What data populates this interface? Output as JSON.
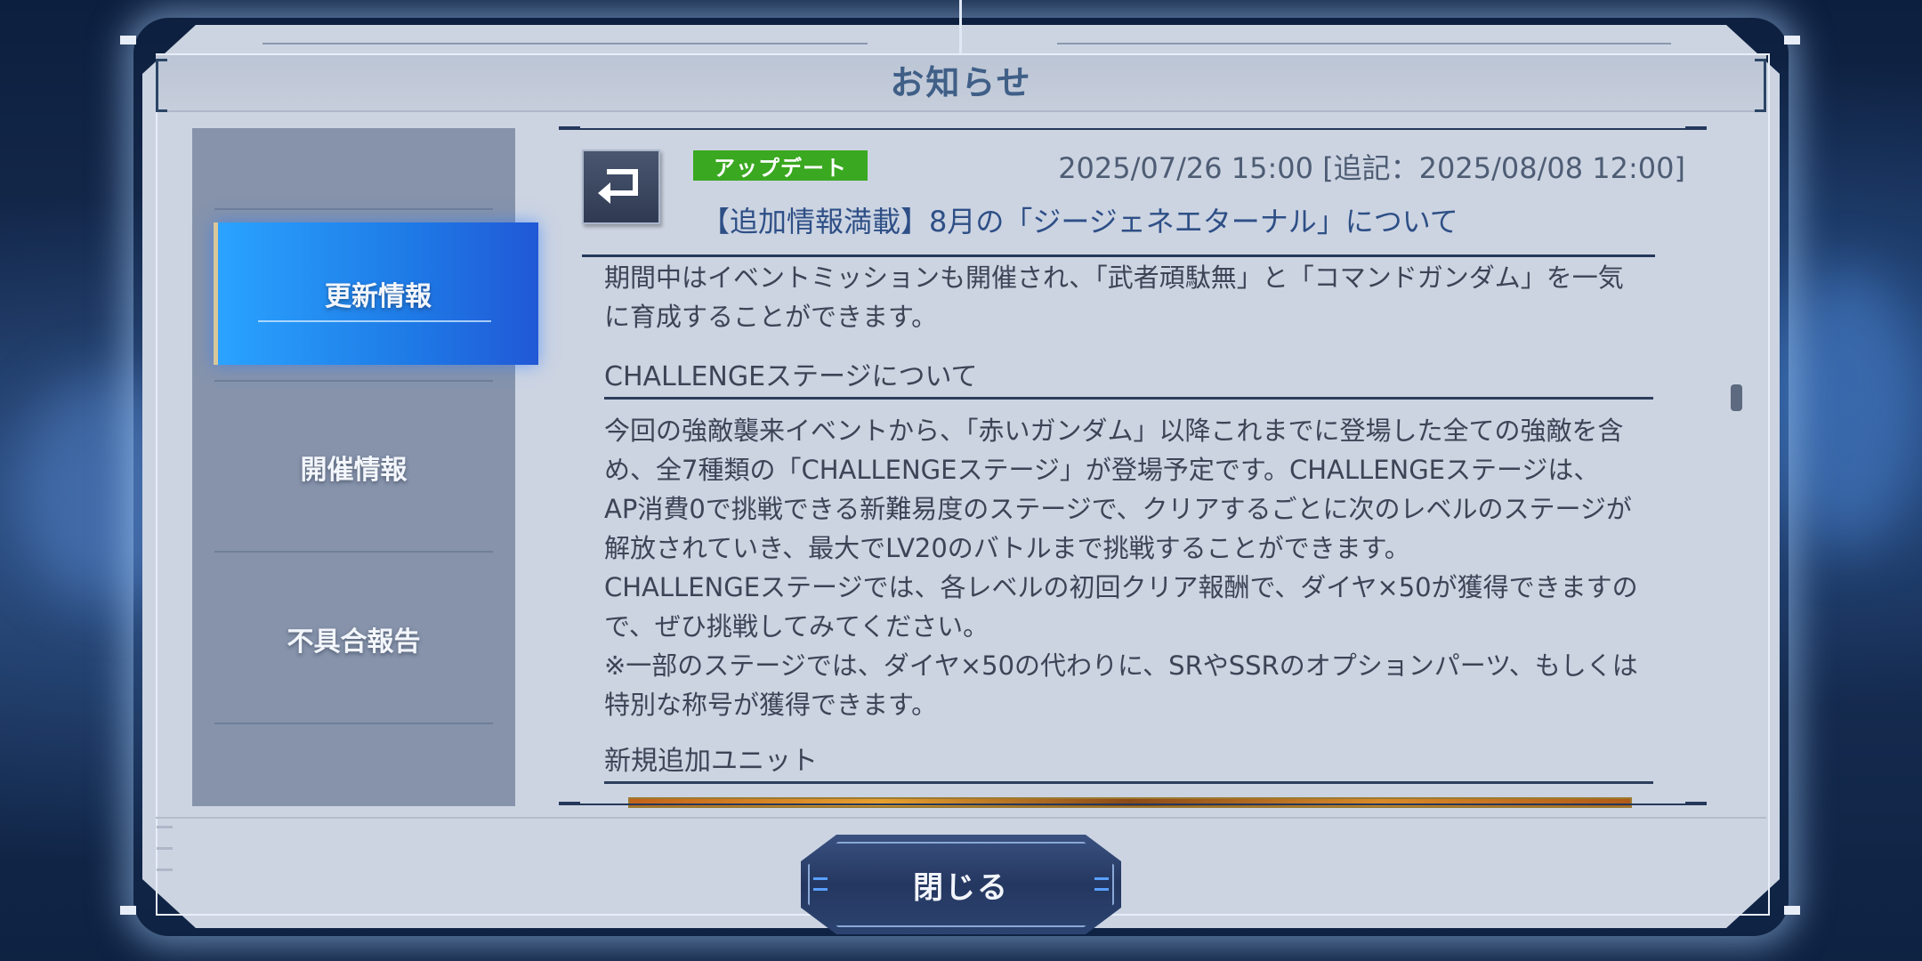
{
  "dialog": {
    "title": "お知らせ",
    "close_label": "閉じる"
  },
  "sidebar": {
    "items": [
      {
        "label": "更新情報",
        "active": true
      },
      {
        "label": "開催情報",
        "active": false
      },
      {
        "label": "不具合報告",
        "active": false
      }
    ]
  },
  "article": {
    "tag": "アップデート",
    "tag_color": "#3aa820",
    "date": "2025/07/26 15:00 [追記：2025/08/08 12:00]",
    "headline": "【追加情報満載】8月の「ジージェネエターナル」について",
    "intro_lines": [
      "期間中はイベントミッションも開催され、「武者頑駄無」と「コマンドガンダム」を一気",
      "に育成することができます。"
    ],
    "sections": [
      {
        "heading": "CHALLENGEステージについて",
        "lines": [
          "今回の強敵襲来イベントから、「赤いガンダム」以降これまでに登場した全ての強敵を含",
          "め、全7種類の「CHALLENGEステージ」が登場予定です。CHALLENGEステージは、",
          "AP消費0で挑戦できる新難易度のステージで、クリアするごとに次のレベルのステージが",
          "解放されていき、最大でLV20のバトルまで挑戦することができます。",
          "CHALLENGEステージでは、各レベルの初回クリア報酬で、ダイヤ×50が獲得できますの",
          "で、ぜひ挑戦してみてください。",
          "※一部のステージでは、ダイヤ×50の代わりに、SRやSSRのオプションパーツ、もしくは",
          "特別な称号が獲得できます。"
        ]
      },
      {
        "heading": "新規追加ユニット",
        "lines": []
      }
    ]
  },
  "icons": {
    "back": "return-arrow-icon"
  }
}
